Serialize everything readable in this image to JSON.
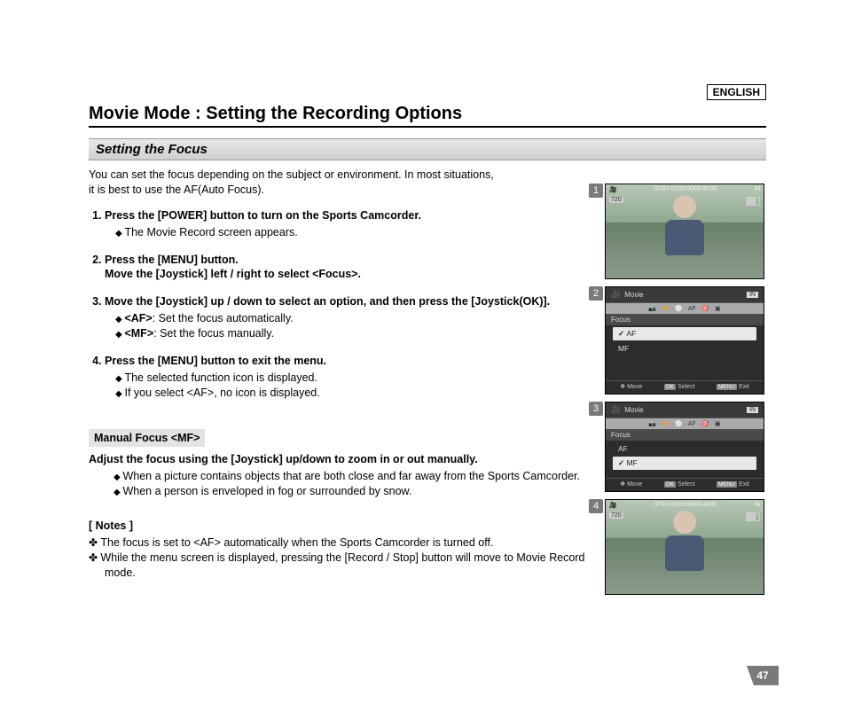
{
  "language": "ENGLISH",
  "chapter": "Movie Mode : Setting the Recording Options",
  "section": "Setting the Focus",
  "intro_l1": "You can set the focus depending on the subject or environment. In most situations,",
  "intro_l2": "it is best to use the AF(Auto Focus).",
  "steps": {
    "s1": {
      "head": "Press the [POWER] button to turn on the Sports Camcorder.",
      "b1": "The Movie Record screen appears."
    },
    "s2": {
      "head_l1": "Press the [MENU] button.",
      "head_l2": "Move the [Joystick] left / right to select <Focus>."
    },
    "s3": {
      "head": "Move the [Joystick] up / down to select an option, and then press the [Joystick(OK)].",
      "b1_strong": "<AF>",
      "b1_rest": ": Set the focus automatically.",
      "b2_strong": "<MF>",
      "b2_rest": ": Set the focus manually."
    },
    "s4": {
      "head": "Press the [MENU] button to exit the menu.",
      "b1": "The selected function icon is displayed.",
      "b2": "If you select <AF>, no icon is displayed."
    }
  },
  "mf": {
    "label": "Manual Focus <MF>",
    "title": "Adjust the focus using the [Joystick] up/down to zoom in or out manually.",
    "b1": "When a picture contains objects that are both close and far away from the Sports Camcorder.",
    "b2": "When a person is enveloped in fog or surrounded by snow."
  },
  "notes": {
    "title": "[ Notes ]",
    "n1": "The focus is set to <AF> automatically when the Sports Camcorder is turned off.",
    "n2": "While the menu screen is displayed, pressing the [Record / Stop] button will move to Movie Record mode."
  },
  "shots": {
    "num1": "1",
    "num2": "2",
    "num3": "3",
    "num4": "4",
    "stby": "STBY 00:00:00/00:40:05",
    "res": "720",
    "in": "IN",
    "movie": "Movie",
    "focus": "Focus",
    "af": "AF",
    "mf": "MF",
    "move": "Move",
    "select": "Select",
    "exit": "Exit",
    "ok": "OK",
    "menu": "MENU",
    "tabs": "📷 · 🔆 · ⚪ · AF · 🎯 · ▣"
  },
  "page_number": "47"
}
